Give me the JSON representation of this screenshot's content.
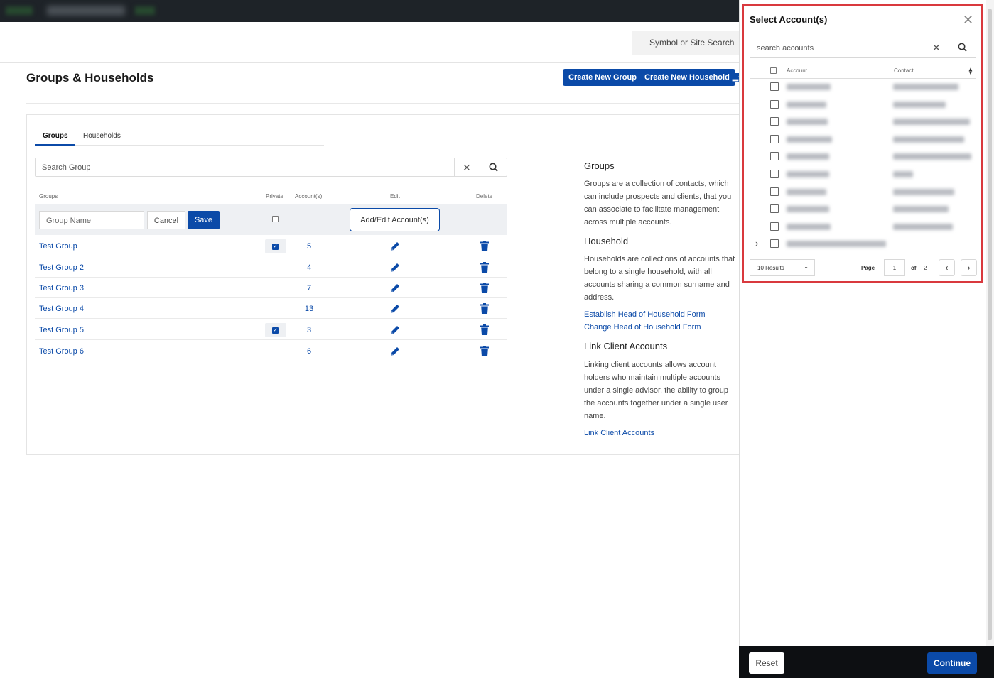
{
  "header": {
    "site_search_placeholder": "Symbol or Site Search"
  },
  "page": {
    "title": "Groups & Households",
    "create_group_label": "Create New Group",
    "create_household_label": "Create New Household"
  },
  "tabs": [
    {
      "label": "Groups",
      "active": true
    },
    {
      "label": "Households",
      "active": false
    }
  ],
  "group_search": {
    "placeholder": "Search Group"
  },
  "table": {
    "headers": {
      "groups": "Groups",
      "private": "Private",
      "accounts": "Account(s)",
      "edit": "Edit",
      "delete": "Delete"
    },
    "edit_row": {
      "name_placeholder": "Group Name",
      "cancel_label": "Cancel",
      "save_label": "Save",
      "add_edit_label": "Add/Edit Account(s)",
      "private_checked": false
    },
    "rows": [
      {
        "name": "Test Group",
        "private": true,
        "accounts": "5"
      },
      {
        "name": "Test Group 2",
        "private": false,
        "accounts": "4"
      },
      {
        "name": "Test Group 3",
        "private": false,
        "accounts": "7"
      },
      {
        "name": "Test Group 4",
        "private": false,
        "accounts": "13"
      },
      {
        "name": "Test Group 5",
        "private": true,
        "accounts": "3"
      },
      {
        "name": "Test Group 6",
        "private": false,
        "accounts": "6"
      }
    ]
  },
  "info": {
    "groups_heading": "Groups",
    "groups_text": [
      "Groups are a collection of contacts, which",
      "can include prospects and clients, that you",
      "can associate to facilitate management",
      "across multiple accounts."
    ],
    "household_heading": "Household",
    "household_text": [
      "Households are collections of accounts that",
      "belong to a single household, with all",
      "accounts sharing a common surname and",
      "address."
    ],
    "establish_link": "Establish Head of Household Form",
    "change_link": "Change Head of Household Form",
    "link_heading": "Link Client Accounts",
    "link_text": [
      "Linking client accounts allows account",
      "holders who maintain multiple accounts",
      "under a single advisor, the ability to group",
      "the accounts together under a single user",
      "name."
    ],
    "link_link": "Link Client Accounts"
  },
  "dialog": {
    "title": "Select Account(s)",
    "search_placeholder": "search accounts",
    "col_account": "Account",
    "col_contact": "Contact",
    "rows_visible": 10,
    "results_label": "10 Results",
    "page_label": "Page",
    "page_value": "1",
    "of_label": "of",
    "total_pages": "2"
  },
  "footer": {
    "reset_label": "Reset",
    "continue_label": "Continue"
  },
  "colors": {
    "accent": "#0b4aa8",
    "highlight_border": "#d9393e",
    "topbar": "#1e2328"
  }
}
